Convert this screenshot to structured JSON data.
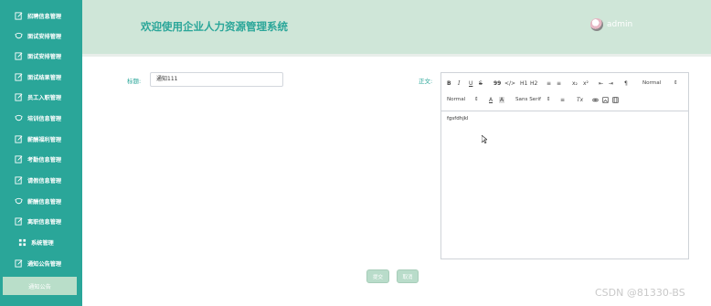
{
  "sidebar": {
    "items": [
      {
        "label": "招聘信息管理",
        "icon": "edit-icon"
      },
      {
        "label": "面试安排管理",
        "icon": "shield-icon"
      },
      {
        "label": "面试安排管理",
        "icon": "edit-icon"
      },
      {
        "label": "面试结果管理",
        "icon": "edit-icon"
      },
      {
        "label": "员工入职管理",
        "icon": "edit-icon"
      },
      {
        "label": "培训信息管理",
        "icon": "shield-icon"
      },
      {
        "label": "薪酬福利管理",
        "icon": "edit-icon"
      },
      {
        "label": "考勤信息管理",
        "icon": "edit-icon"
      },
      {
        "label": "请假信息管理",
        "icon": "edit-icon"
      },
      {
        "label": "薪酬信息管理",
        "icon": "shield-icon"
      },
      {
        "label": "离职信息管理",
        "icon": "edit-icon"
      },
      {
        "label": "系统管理",
        "icon": "grid-icon"
      },
      {
        "label": "通知公告管理",
        "icon": "edit-icon"
      }
    ],
    "active_item": "通知公告"
  },
  "header": {
    "title": "欢迎使用企业人力资源管理系统",
    "username": "admin"
  },
  "form": {
    "title_label": "标题:",
    "title_value": "通知111",
    "content_label": "正文:",
    "content_text": "fgsfdhjkl"
  },
  "editor": {
    "toolbar": {
      "bold": "B",
      "italic": "I",
      "underline": "U",
      "strike": "S",
      "blockquote": "99",
      "code": "</>",
      "h1": "H1",
      "h2": "H2",
      "ol": "≡",
      "ul": "≡",
      "sub": "x₂",
      "sup": "x²",
      "indent_left": "⇤",
      "indent_right": "⇥",
      "direction": "¶",
      "size_value": "Normal",
      "header_value": "Normal",
      "font_color": "A",
      "background": "A",
      "font_value": "Sans Serif",
      "align": "≡",
      "clean": "Tx",
      "link": "🔗",
      "image": "▣",
      "video": "▦"
    }
  },
  "buttons": {
    "submit": "提交",
    "cancel": "取消"
  },
  "watermark": "CSDN @81330-BS"
}
